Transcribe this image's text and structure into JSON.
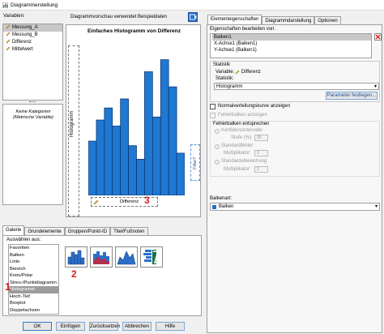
{
  "window": {
    "title": "Diagrammerstellung"
  },
  "variables": {
    "label": "Variablen:",
    "items": [
      {
        "name": "Messung_A",
        "selected": true
      },
      {
        "name": "Messung_B",
        "selected": false
      },
      {
        "name": "Differenz",
        "selected": false
      },
      {
        "name": "Mittelwert",
        "selected": false
      }
    ],
    "categories_note": "Keine Kategorien (Metrische Variable)"
  },
  "preview": {
    "notice": "Diagrammvorschau verwendet Beispieldaten",
    "chart_title": "Einfaches Histogramm von Differenz",
    "y_axis_zone": "Histogramm",
    "x_axis_drop_label": "Differenz",
    "filter_zone": "Filter?",
    "bar_heights": [
      0.36,
      0.5,
      0.58,
      0.46,
      0.64,
      0.33,
      0.24,
      0.82,
      0.52,
      0.9,
      0.72,
      0.28
    ],
    "annotation": "3"
  },
  "gallery_tabs": [
    "Galerie",
    "Grundelemente",
    "Gruppen/Punkt-ID",
    "Titel/Fußnoten"
  ],
  "gallery": {
    "choose_label": "Auswählen aus:",
    "items": [
      "Favoriten",
      "Balken",
      "Linie",
      "Bereich",
      "Kreis/Polar",
      "Streu-/Punktdiagramm",
      "Histogramm",
      "Hoch-Tief",
      "Boxplot",
      "Doppelachsen"
    ],
    "selected": "Histogramm",
    "annotation_list": "1",
    "annotation_thumbs": "2"
  },
  "buttons": {
    "ok": "OK",
    "paste": "Einfügen",
    "reset": "Zurücksetzen",
    "cancel": "Abbrechen",
    "help": "Hilfe"
  },
  "right_tabs": [
    "Elementeigenschaften",
    "Diagrammdarstellung",
    "Optionen"
  ],
  "properties": {
    "edit_label": "Eigenschaften bearbeiten von:",
    "items": [
      "Balken1",
      "X-Achse1 (Balken1)",
      "Y-Achse1 (Balken1)"
    ],
    "selected": "Balken1",
    "statistic_group": "Statistik",
    "variable_label": "Variable:",
    "variable_value": "Differenz",
    "statistic_label": "Statistik:",
    "statistic_value": "Histogramm",
    "params_button": "Parameter festlegen...",
    "normal_curve": "Normalverteilungskurve anzeigen",
    "error_bars": "Fehlerbalken anzeigen",
    "error_group": "Fehlerbalken entsprechen",
    "ci_label": "Konfidenzintervalle",
    "level_label": "Stufe (%):",
    "level_value": "95",
    "se_label": "Standardfehler",
    "se_mult_label": "Multiplikator:",
    "se_mult_value": "2",
    "sd_label": "Standardabweichung",
    "sd_mult_label": "Multiplikator:",
    "sd_mult_value": "2",
    "bar_type_label": "Balkenart:",
    "bar_type_value": "Balken"
  },
  "colors": {
    "bar": "#1f78d1",
    "accent": "#2a6fc9",
    "red": "#d01f1f"
  }
}
